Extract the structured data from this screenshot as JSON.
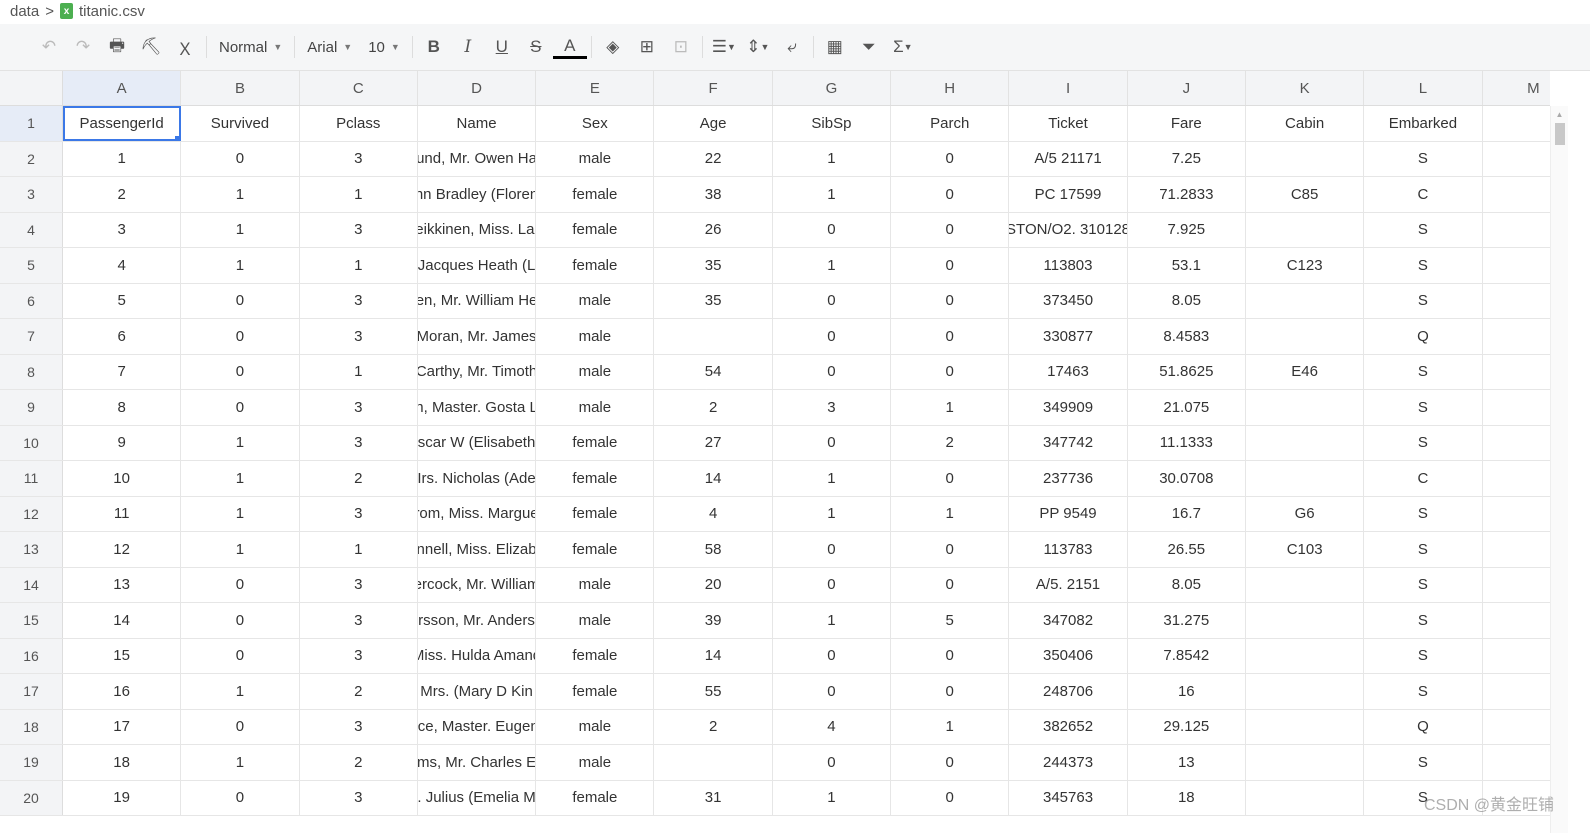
{
  "breadcrumb": {
    "folder": "data",
    "file": "titanic.csv",
    "file_icon": "excel-file-icon"
  },
  "toolbar": {
    "style": "Normal",
    "font": "Arial",
    "size": "10",
    "colors": {
      "accent": "#3b78e7",
      "header_bg": "#f3f4f6"
    }
  },
  "columns": [
    "A",
    "B",
    "C",
    "D",
    "E",
    "F",
    "G",
    "H",
    "I",
    "J",
    "K",
    "L",
    "M"
  ],
  "rows": [
    [
      "PassengerId",
      "Survived",
      "Pclass",
      "Name",
      "Sex",
      "Age",
      "SibSp",
      "Parch",
      "Ticket",
      "Fare",
      "Cabin",
      "Embarked"
    ],
    [
      "1",
      "0",
      "3",
      "und, Mr. Owen Ha",
      "male",
      "22",
      "1",
      "0",
      "A/5 21171",
      "7.25",
      "",
      "S"
    ],
    [
      "2",
      "1",
      "1",
      "nn Bradley (Floren",
      "female",
      "38",
      "1",
      "0",
      "PC 17599",
      "71.2833",
      "C85",
      "C"
    ],
    [
      "3",
      "1",
      "3",
      "eikkinen, Miss. Lai",
      "female",
      "26",
      "0",
      "0",
      "STON/O2. 310128",
      "7.925",
      "",
      "S"
    ],
    [
      "4",
      "1",
      "1",
      " Jacques Heath (L",
      "female",
      "35",
      "1",
      "0",
      "113803",
      "53.1",
      "C123",
      "S"
    ],
    [
      "5",
      "0",
      "3",
      "en, Mr. William He",
      "male",
      "35",
      "0",
      "0",
      "373450",
      "8.05",
      "",
      "S"
    ],
    [
      "6",
      "0",
      "3",
      "Moran, Mr. James",
      "male",
      "",
      "0",
      "0",
      "330877",
      "8.4583",
      "",
      "Q"
    ],
    [
      "7",
      "0",
      "1",
      "Carthy, Mr. Timoth",
      "male",
      "54",
      "0",
      "0",
      "17463",
      "51.8625",
      "E46",
      "S"
    ],
    [
      "8",
      "0",
      "3",
      "n, Master. Gosta L",
      "male",
      "2",
      "3",
      "1",
      "349909",
      "21.075",
      "",
      "S"
    ],
    [
      "9",
      "1",
      "3",
      "scar W (Elisabeth",
      "female",
      "27",
      "0",
      "2",
      "347742",
      "11.1333",
      "",
      "S"
    ],
    [
      "10",
      "1",
      "2",
      "Irs. Nicholas (Ade",
      "female",
      "14",
      "1",
      "0",
      "237736",
      "30.0708",
      "",
      "C"
    ],
    [
      "11",
      "1",
      "3",
      "rom, Miss. Margue",
      "female",
      "4",
      "1",
      "1",
      "PP 9549",
      "16.7",
      "G6",
      "S"
    ],
    [
      "12",
      "1",
      "1",
      "nnell, Miss. Elizab",
      "female",
      "58",
      "0",
      "0",
      "113783",
      "26.55",
      "C103",
      "S"
    ],
    [
      "13",
      "0",
      "3",
      "ercock, Mr. William",
      "male",
      "20",
      "0",
      "0",
      "A/5. 2151",
      "8.05",
      "",
      "S"
    ],
    [
      "14",
      "0",
      "3",
      "rsson, Mr. Anders",
      "male",
      "39",
      "1",
      "5",
      "347082",
      "31.275",
      "",
      "S"
    ],
    [
      "15",
      "0",
      "3",
      "Miss. Hulda Amand",
      "female",
      "14",
      "0",
      "0",
      "350406",
      "7.8542",
      "",
      "S"
    ],
    [
      "16",
      "1",
      "2",
      " Mrs. (Mary D Kin",
      "female",
      "55",
      "0",
      "0",
      "248706",
      "16",
      "",
      "S"
    ],
    [
      "17",
      "0",
      "3",
      "ice, Master. Eugen",
      "male",
      "2",
      "4",
      "1",
      "382652",
      "29.125",
      "",
      "Q"
    ],
    [
      "18",
      "1",
      "2",
      "ms, Mr. Charles E",
      "male",
      "",
      "0",
      "0",
      "244373",
      "13",
      "",
      "S"
    ],
    [
      "19",
      "0",
      "3",
      ". Julius (Emelia M",
      "female",
      "31",
      "1",
      "0",
      "345763",
      "18",
      "",
      "S"
    ]
  ],
  "watermark": "CSDN @黄金旺铺"
}
